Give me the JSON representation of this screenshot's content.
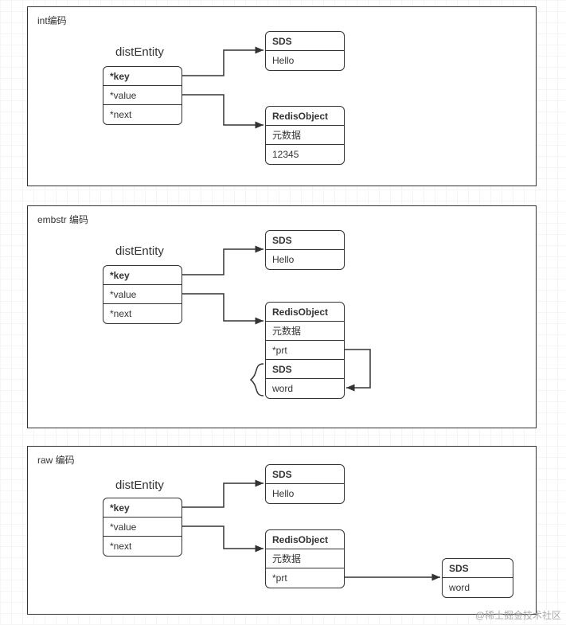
{
  "panels": {
    "int": {
      "label": "int编码",
      "entityTitle": "distEntity",
      "entity": {
        "key": "*key",
        "value": "*value",
        "next": "*next"
      },
      "sds": {
        "header": "SDS",
        "value": "Hello"
      },
      "obj": {
        "header": "RedisObject",
        "meta": "元数据",
        "val": "12345"
      }
    },
    "embstr": {
      "label": "embstr 编码",
      "entityTitle": "distEntity",
      "entity": {
        "key": "*key",
        "value": "*value",
        "next": "*next"
      },
      "sds": {
        "header": "SDS",
        "value": "Hello"
      },
      "obj": {
        "header": "RedisObject",
        "meta": "元数据",
        "prt": "*prt",
        "sdsHeader": "SDS",
        "sdsVal": "word"
      }
    },
    "raw": {
      "label": "raw 编码",
      "entityTitle": "distEntity",
      "entity": {
        "key": "*key",
        "value": "*value",
        "next": "*next"
      },
      "sds": {
        "header": "SDS",
        "value": "Hello"
      },
      "obj": {
        "header": "RedisObject",
        "meta": "元数据",
        "prt": "*prt"
      },
      "sds2": {
        "header": "SDS",
        "value": "word"
      }
    }
  },
  "watermark": "@稀土掘金技术社区"
}
